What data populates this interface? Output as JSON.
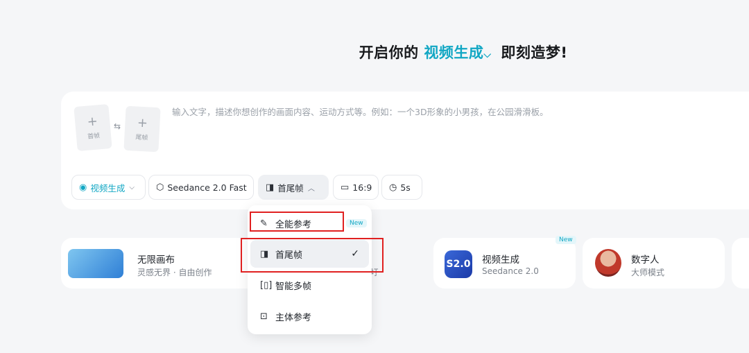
{
  "headline": {
    "prefix": "开启你的",
    "accent": "视频生成",
    "suffix": "即刻造梦!"
  },
  "prompt": {
    "first_frame_label": "首帧",
    "last_frame_label": "尾帧",
    "placeholder": "输入文字，描述你想创作的画面内容、运动方式等。例如：一个3D形象的小男孩，在公园滑滑板。"
  },
  "toolbar": {
    "mode": "视频生成",
    "model": "Seedance 2.0 Fast",
    "frame_mode": "首尾帧",
    "ratio": "16:9",
    "duration": "5s"
  },
  "dropdown": {
    "items": [
      {
        "label": "全能参考",
        "badge": "New",
        "icon": "all-reference-icon"
      },
      {
        "label": "首尾帧",
        "icon": "first-last-frame-icon",
        "selected": true
      },
      {
        "label": "智能多帧",
        "icon": "multi-frame-icon"
      },
      {
        "label": "主体参考",
        "icon": "subject-reference-icon"
      }
    ]
  },
  "features": {
    "canvas": {
      "title": "无限画布",
      "subtitle": "灵感无界 · 自由创作"
    },
    "hidden_fragment": "圩",
    "video": {
      "title": "视频生成",
      "subtitle": "Seedance 2.0",
      "badge": "New",
      "logo_text": "S2.0"
    },
    "human": {
      "title": "数字人",
      "subtitle": "大师模式"
    }
  },
  "colors": {
    "accent": "#12a7c4",
    "highlight": "#e02020",
    "background": "#f5f6f8"
  }
}
